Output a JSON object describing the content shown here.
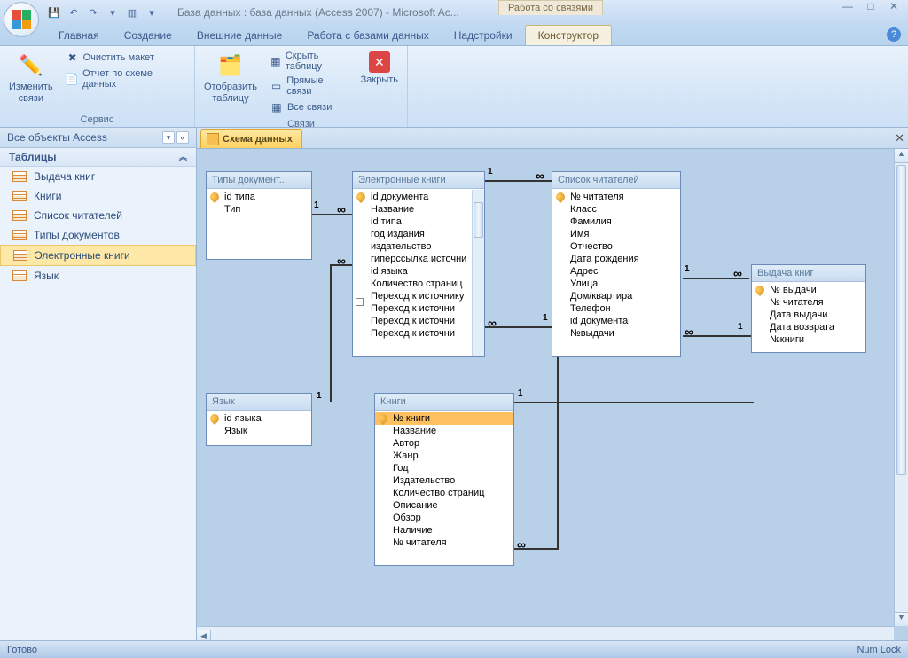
{
  "title": "База данных : база данных (Access 2007) - Microsoft Ac...",
  "context_tab": "Работа со связями",
  "ribbon_tabs": [
    "Главная",
    "Создание",
    "Внешние данные",
    "Работа с базами данных",
    "Надстройки",
    "Конструктор"
  ],
  "active_tab": "Конструктор",
  "ribbon": {
    "group1": {
      "label": "Сервис",
      "edit_links": "Изменить\nсвязи",
      "clear_layout": "Очистить макет",
      "rel_report": "Отчет по схеме данных"
    },
    "group2": {
      "label": "Связи",
      "show_table": "Отобразить\nтаблицу",
      "hide_table": "Скрыть таблицу",
      "direct_links": "Прямые связи",
      "all_links": "Все связи",
      "close": "Закрыть"
    }
  },
  "nav": {
    "header": "Все объекты Access",
    "section": "Таблицы",
    "items": [
      "Выдача книг",
      "Книги",
      "Список читателей",
      "Типы документов",
      "Электронные книги",
      "Язык"
    ],
    "selected": "Электронные книги"
  },
  "doc_tab": "Схема данных",
  "tables": {
    "doc_types": {
      "title": "Типы документ...",
      "fields": [
        {
          "n": "id типа",
          "pk": true
        },
        {
          "n": "Тип"
        }
      ]
    },
    "ebooks": {
      "title": "Электронные книги",
      "fields": [
        {
          "n": "id документа",
          "pk": true
        },
        {
          "n": "Название"
        },
        {
          "n": "id типа"
        },
        {
          "n": "год издания"
        },
        {
          "n": "издательство"
        },
        {
          "n": "гиперссылка источни"
        },
        {
          "n": "id языка"
        },
        {
          "n": "Количество страниц"
        },
        {
          "n": "Переход к источнику"
        },
        {
          "n": "Переход к источни"
        },
        {
          "n": "Переход к источни"
        },
        {
          "n": "Переход к источни"
        }
      ]
    },
    "readers": {
      "title": "Список читателей",
      "fields": [
        {
          "n": "№ читателя",
          "pk": true
        },
        {
          "n": "Класс"
        },
        {
          "n": "Фамилия"
        },
        {
          "n": "Имя"
        },
        {
          "n": "Отчество"
        },
        {
          "n": "Дата рождения"
        },
        {
          "n": "Адрес"
        },
        {
          "n": "Улица"
        },
        {
          "n": "Дом/квартира"
        },
        {
          "n": "Телефон"
        },
        {
          "n": "id документа"
        },
        {
          "n": "№выдачи"
        }
      ]
    },
    "loans": {
      "title": "Выдача книг",
      "fields": [
        {
          "n": "№ выдачи",
          "pk": true
        },
        {
          "n": "№ читателя"
        },
        {
          "n": "Дата выдачи"
        },
        {
          "n": "Дата возврата"
        },
        {
          "n": "№книги"
        }
      ]
    },
    "lang": {
      "title": "Язык",
      "fields": [
        {
          "n": "id языка",
          "pk": true
        },
        {
          "n": "Язык"
        }
      ]
    },
    "books": {
      "title": "Книги",
      "fields": [
        {
          "n": "№ книги",
          "pk": true,
          "sel": true
        },
        {
          "n": "Название"
        },
        {
          "n": "Автор"
        },
        {
          "n": "Жанр"
        },
        {
          "n": "Год"
        },
        {
          "n": "Издательство"
        },
        {
          "n": "Количество страниц"
        },
        {
          "n": "Описание"
        },
        {
          "n": "Обзор"
        },
        {
          "n": "Наличие"
        },
        {
          "n": "№ читателя"
        }
      ]
    }
  },
  "status": {
    "left": "Готово",
    "right": "Num Lock"
  }
}
